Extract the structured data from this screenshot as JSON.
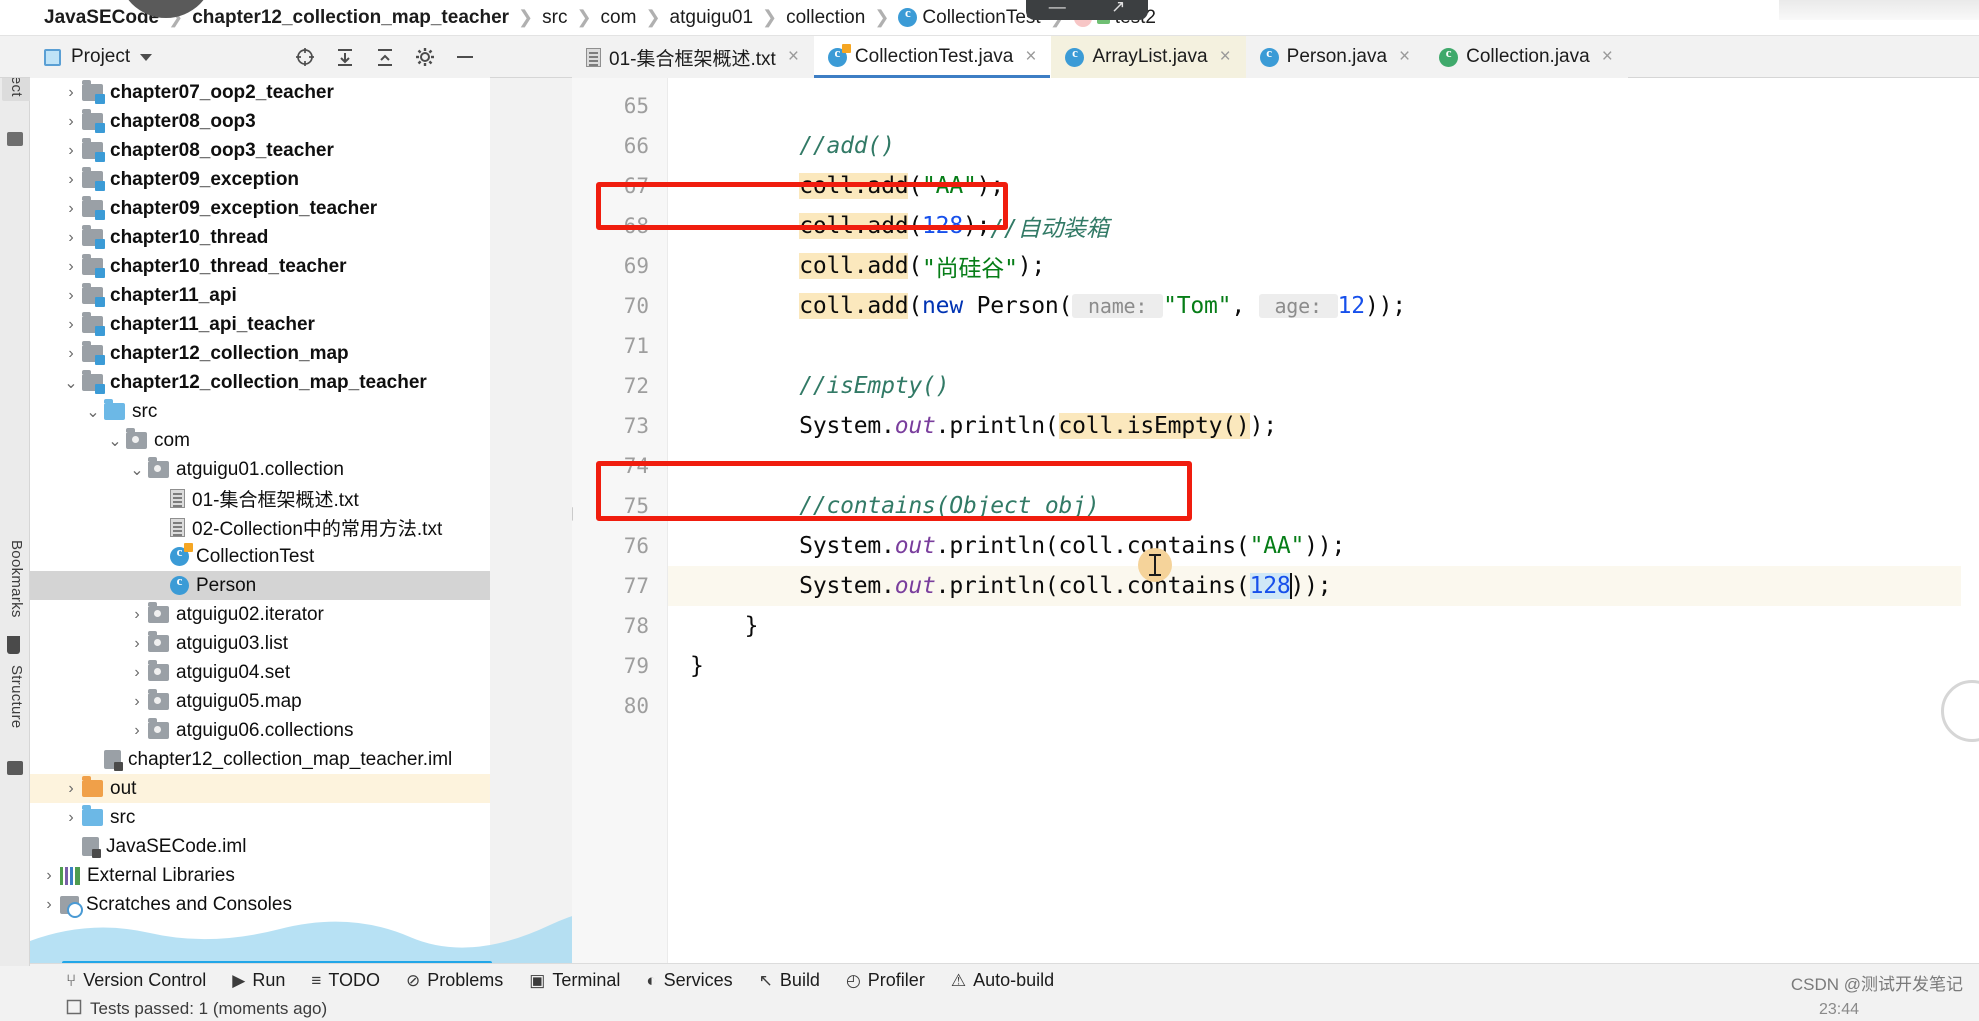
{
  "window": {
    "minimize_label": "—",
    "maximize_label": "↗"
  },
  "breadcrumb": [
    {
      "label": "JavaSECode",
      "icon": "",
      "bold": true
    },
    {
      "label": "chapter12_collection_map_teacher",
      "icon": "",
      "bold": true
    },
    {
      "label": "src",
      "icon": "",
      "bold": false
    },
    {
      "label": "com",
      "icon": "",
      "bold": false
    },
    {
      "label": "atguigu01",
      "icon": "",
      "bold": false
    },
    {
      "label": "collection",
      "icon": "",
      "bold": false
    },
    {
      "label": "CollectionTest",
      "icon": "class-icon",
      "bold": false
    },
    {
      "label": "test2",
      "icon": "method-icon",
      "bold": false
    }
  ],
  "tool_window": {
    "title": "Project",
    "icons": [
      "locate-icon",
      "expand-all-icon",
      "collapse-all-icon",
      "settings-gear-icon",
      "hide-icon"
    ]
  },
  "left_tool_tabs": [
    "Project",
    "Bookmarks",
    "Structure"
  ],
  "tabs": [
    {
      "label": "01-集合框架概述.txt",
      "icon": "text-file-icon",
      "active": false,
      "tinted": false
    },
    {
      "label": "CollectionTest.java",
      "icon": "runnable-class-icon",
      "active": true,
      "tinted": false
    },
    {
      "label": "ArrayList.java",
      "icon": "class-icon",
      "active": false,
      "tinted": true
    },
    {
      "label": "Person.java",
      "icon": "class-icon",
      "active": false,
      "tinted": false
    },
    {
      "label": "Collection.java",
      "icon": "interface-icon",
      "active": false,
      "tinted": false
    }
  ],
  "tree": [
    {
      "label": "chapter07_oop2_teacher",
      "indent": 1,
      "twist": "collapsed",
      "icon": "module-folder-icon",
      "bold": true,
      "state": ""
    },
    {
      "label": "chapter08_oop3",
      "indent": 1,
      "twist": "collapsed",
      "icon": "module-folder-icon",
      "bold": true,
      "state": ""
    },
    {
      "label": "chapter08_oop3_teacher",
      "indent": 1,
      "twist": "collapsed",
      "icon": "module-folder-icon",
      "bold": true,
      "state": ""
    },
    {
      "label": "chapter09_exception",
      "indent": 1,
      "twist": "collapsed",
      "icon": "module-folder-icon",
      "bold": true,
      "state": ""
    },
    {
      "label": "chapter09_exception_teacher",
      "indent": 1,
      "twist": "collapsed",
      "icon": "module-folder-icon",
      "bold": true,
      "state": ""
    },
    {
      "label": "chapter10_thread",
      "indent": 1,
      "twist": "collapsed",
      "icon": "module-folder-icon",
      "bold": true,
      "state": ""
    },
    {
      "label": "chapter10_thread_teacher",
      "indent": 1,
      "twist": "collapsed",
      "icon": "module-folder-icon",
      "bold": true,
      "state": ""
    },
    {
      "label": "chapter11_api",
      "indent": 1,
      "twist": "collapsed",
      "icon": "module-folder-icon",
      "bold": true,
      "state": ""
    },
    {
      "label": "chapter11_api_teacher",
      "indent": 1,
      "twist": "collapsed",
      "icon": "module-folder-icon",
      "bold": true,
      "state": ""
    },
    {
      "label": "chapter12_collection_map",
      "indent": 1,
      "twist": "collapsed",
      "icon": "module-folder-icon",
      "bold": true,
      "state": ""
    },
    {
      "label": "chapter12_collection_map_teacher",
      "indent": 1,
      "twist": "expanded",
      "icon": "module-folder-icon",
      "bold": true,
      "state": ""
    },
    {
      "label": "src",
      "indent": 2,
      "twist": "expanded",
      "icon": "source-folder-icon",
      "bold": false,
      "state": ""
    },
    {
      "label": "com",
      "indent": 3,
      "twist": "expanded",
      "icon": "package-folder-icon",
      "bold": false,
      "state": ""
    },
    {
      "label": "atguigu01.collection",
      "indent": 4,
      "twist": "expanded",
      "icon": "package-folder-icon",
      "bold": false,
      "state": ""
    },
    {
      "label": "01-集合框架概述.txt",
      "indent": 5,
      "twist": "none",
      "icon": "text-file-icon",
      "bold": false,
      "state": ""
    },
    {
      "label": "02-Collection中的常用方法.txt",
      "indent": 5,
      "twist": "none",
      "icon": "text-file-icon",
      "bold": false,
      "state": ""
    },
    {
      "label": "CollectionTest",
      "indent": 5,
      "twist": "none",
      "icon": "runnable-class-icon",
      "bold": false,
      "state": ""
    },
    {
      "label": "Person",
      "indent": 5,
      "twist": "none",
      "icon": "class-icon",
      "bold": false,
      "state": "selected"
    },
    {
      "label": "atguigu02.iterator",
      "indent": 4,
      "twist": "collapsed",
      "icon": "package-folder-icon",
      "bold": false,
      "state": ""
    },
    {
      "label": "atguigu03.list",
      "indent": 4,
      "twist": "collapsed",
      "icon": "package-folder-icon",
      "bold": false,
      "state": ""
    },
    {
      "label": "atguigu04.set",
      "indent": 4,
      "twist": "collapsed",
      "icon": "package-folder-icon",
      "bold": false,
      "state": ""
    },
    {
      "label": "atguigu05.map",
      "indent": 4,
      "twist": "collapsed",
      "icon": "package-folder-icon",
      "bold": false,
      "state": ""
    },
    {
      "label": "atguigu06.collections",
      "indent": 4,
      "twist": "collapsed",
      "icon": "package-folder-icon",
      "bold": false,
      "state": ""
    },
    {
      "label": "chapter12_collection_map_teacher.iml",
      "indent": 2,
      "twist": "none",
      "icon": "iml-file-icon",
      "bold": false,
      "state": ""
    },
    {
      "label": "out",
      "indent": 1,
      "twist": "collapsed",
      "icon": "output-folder-icon",
      "bold": false,
      "state": "highlighted"
    },
    {
      "label": "src",
      "indent": 1,
      "twist": "collapsed",
      "icon": "source-folder-icon",
      "bold": false,
      "state": ""
    },
    {
      "label": "JavaSECode.iml",
      "indent": 1,
      "twist": "none",
      "icon": "iml-file-icon",
      "bold": false,
      "state": ""
    },
    {
      "label": "External Libraries",
      "indent": 0,
      "twist": "collapsed",
      "icon": "libraries-icon",
      "bold": false,
      "state": ""
    },
    {
      "label": "Scratches and Consoles",
      "indent": 0,
      "twist": "collapsed",
      "icon": "scratches-icon",
      "bold": false,
      "state": ""
    }
  ],
  "editor": {
    "first_line_number": 65,
    "line_numbers": [
      65,
      66,
      67,
      68,
      69,
      70,
      71,
      72,
      73,
      74,
      75,
      76,
      77,
      78,
      79,
      80
    ],
    "lines": [
      {
        "n": 65,
        "segments": []
      },
      {
        "n": 66,
        "segments": [
          {
            "t": "        ",
            "c": ""
          },
          {
            "t": "//add()",
            "c": "cmt"
          }
        ]
      },
      {
        "n": 67,
        "segments": [
          {
            "t": "        ",
            "c": ""
          },
          {
            "t": "coll.add",
            "c": "occ"
          },
          {
            "t": "(",
            "c": ""
          },
          {
            "t": "\"AA\"",
            "c": "str"
          },
          {
            "t": ");",
            "c": ""
          }
        ]
      },
      {
        "n": 68,
        "segments": [
          {
            "t": "        ",
            "c": ""
          },
          {
            "t": "coll.add",
            "c": "occ"
          },
          {
            "t": "(",
            "c": ""
          },
          {
            "t": "128",
            "c": "num"
          },
          {
            "t": ");",
            "c": ""
          },
          {
            "t": "//自动装箱",
            "c": "cmt"
          }
        ]
      },
      {
        "n": 69,
        "segments": [
          {
            "t": "        ",
            "c": ""
          },
          {
            "t": "coll.add",
            "c": "occ"
          },
          {
            "t": "(",
            "c": ""
          },
          {
            "t": "\"尚硅谷\"",
            "c": "str"
          },
          {
            "t": ");",
            "c": ""
          }
        ]
      },
      {
        "n": 70,
        "segments": [
          {
            "t": "        ",
            "c": ""
          },
          {
            "t": "coll.add",
            "c": "occ"
          },
          {
            "t": "(",
            "c": ""
          },
          {
            "t": "new",
            "c": "kw"
          },
          {
            "t": " Person(",
            "c": ""
          },
          {
            "t": " name: ",
            "c": "hint"
          },
          {
            "t": "\"Tom\"",
            "c": "str"
          },
          {
            "t": ", ",
            "c": ""
          },
          {
            "t": " age: ",
            "c": "hint"
          },
          {
            "t": "12",
            "c": "num"
          },
          {
            "t": "));",
            "c": ""
          }
        ]
      },
      {
        "n": 71,
        "segments": []
      },
      {
        "n": 72,
        "segments": [
          {
            "t": "        ",
            "c": ""
          },
          {
            "t": "//isEmpty()",
            "c": "cmt"
          }
        ]
      },
      {
        "n": 73,
        "segments": [
          {
            "t": "        System.",
            "c": ""
          },
          {
            "t": "out",
            "c": "fld"
          },
          {
            "t": ".println(",
            "c": ""
          },
          {
            "t": "coll.isEmpty()",
            "c": "occ"
          },
          {
            "t": ");",
            "c": ""
          }
        ]
      },
      {
        "n": 74,
        "segments": []
      },
      {
        "n": 75,
        "segments": [
          {
            "t": "        ",
            "c": ""
          },
          {
            "t": "//contains(Object obj)",
            "c": "cmt"
          }
        ]
      },
      {
        "n": 76,
        "segments": [
          {
            "t": "        System.",
            "c": ""
          },
          {
            "t": "out",
            "c": "fld"
          },
          {
            "t": ".println(coll.contains(",
            "c": ""
          },
          {
            "t": "\"AA\"",
            "c": "str"
          },
          {
            "t": "));",
            "c": ""
          }
        ]
      },
      {
        "n": 77,
        "segments": [
          {
            "t": "        System.",
            "c": ""
          },
          {
            "t": "out",
            "c": "fld"
          },
          {
            "t": ".println(coll.contains(",
            "c": ""
          },
          {
            "t": "128",
            "c": "selnum"
          },
          {
            "t": "));",
            "c": ""
          }
        ]
      },
      {
        "n": 78,
        "segments": [
          {
            "t": "    }",
            "c": ""
          }
        ]
      },
      {
        "n": 79,
        "segments": [
          {
            "t": "}",
            "c": ""
          }
        ]
      },
      {
        "n": 80,
        "segments": []
      }
    ],
    "annotation_boxes": [
      {
        "name": "add-128-highlight",
        "line": 68
      },
      {
        "name": "contains-128-highlight",
        "line": 77
      }
    ],
    "accent_colors": {
      "annotation_red": "#f01d0e",
      "keyword_blue": "#0033b3",
      "number_blue": "#1750eb",
      "string_green": "#067d17",
      "comment_teal": "#327a66",
      "occurrence_highlight": "#fbe8bd",
      "selection_highlight": "#cfe8f7"
    }
  },
  "statusbar": {
    "items": [
      {
        "label": "Version Control",
        "icon": "branch-icon"
      },
      {
        "label": "Run",
        "icon": "play-icon"
      },
      {
        "label": "TODO",
        "icon": "list-icon"
      },
      {
        "label": "Problems",
        "icon": "problems-icon"
      },
      {
        "label": "Terminal",
        "icon": "terminal-icon"
      },
      {
        "label": "Services",
        "icon": "services-icon"
      },
      {
        "label": "Build",
        "icon": "hammer-icon"
      },
      {
        "label": "Profiler",
        "icon": "profiler-icon"
      },
      {
        "label": "Auto-build",
        "icon": "warning-icon"
      }
    ],
    "test_status": "Tests passed: 1 (moments ago)",
    "watermark": "CSDN @测试开发笔记",
    "clock": "23:44"
  }
}
